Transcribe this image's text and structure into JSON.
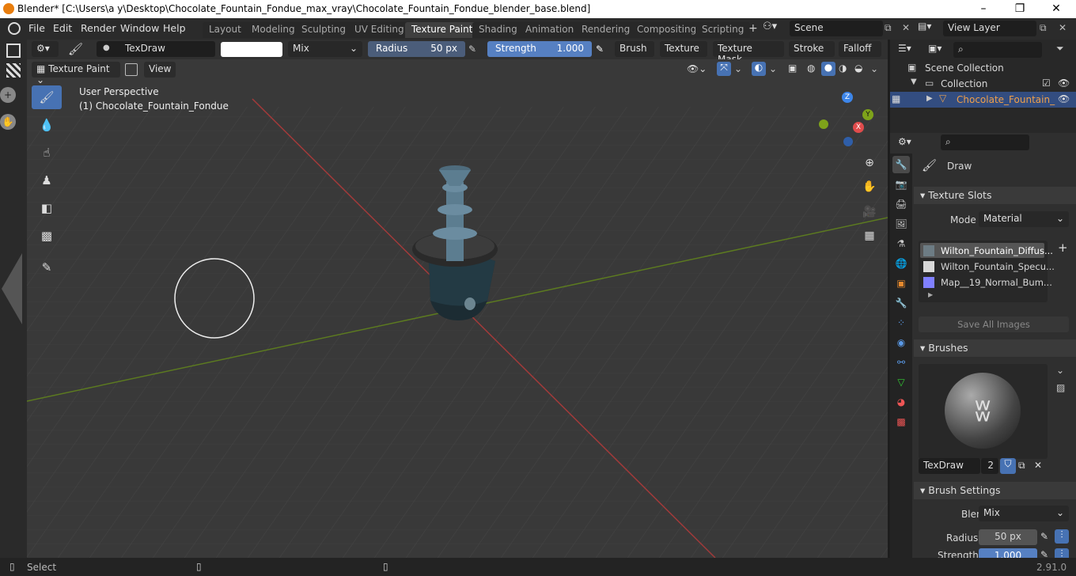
{
  "window": {
    "title": "Blender* [C:\\Users\\a y\\Desktop\\Chocolate_Fountain_Fondue_max_vray\\Chocolate_Fountain_Fondue_blender_base.blend]"
  },
  "menu": [
    "File",
    "Edit",
    "Render",
    "Window",
    "Help"
  ],
  "workspaces": [
    "Layout",
    "Modeling",
    "Sculpting",
    "UV Editing",
    "Texture Paint",
    "Shading",
    "Animation",
    "Rendering",
    "Compositing",
    "Scripting"
  ],
  "active_workspace": "Texture Paint",
  "scene": {
    "name": "Scene"
  },
  "view_layer": {
    "name": "View Layer"
  },
  "tool_header": {
    "brush_name": "TexDraw",
    "blend": "Mix",
    "radius_label": "Radius",
    "radius_value": "50 px",
    "strength_label": "Strength",
    "strength_value": "1.000",
    "menus": [
      "Brush",
      "Texture",
      "Texture Mask",
      "Stroke",
      "Falloff"
    ]
  },
  "mode_header": {
    "mode": "Texture Paint",
    "view": "View"
  },
  "viewport": {
    "perspective": "User Perspective",
    "object": "(1) Chocolate_Fountain_Fondue",
    "gizmo": {
      "z": "Z",
      "y": "Y",
      "x": "X"
    }
  },
  "outliner": {
    "scene_collection": "Scene Collection",
    "collection": "Collection",
    "object": "Chocolate_Fountain_"
  },
  "properties": {
    "active_tool": "Draw",
    "texture_slots_title": "Texture Slots",
    "mode_label": "Mode",
    "mode_value": "Material",
    "slots": [
      {
        "name": "Wilton_Fountain_Diffus...",
        "color": "#6d7c84"
      },
      {
        "name": "Wilton_Fountain_Specu...",
        "color": "#d8d8d8"
      },
      {
        "name": "Map__19_Normal_Bum...",
        "color": "#8080ff"
      }
    ],
    "save_all": "Save All Images",
    "brushes_title": "Brushes",
    "brush_name": "TexDraw",
    "brush_users": "2",
    "brush_settings_title": "Brush Settings",
    "blend_label": "Blend",
    "blend_value": "Mix",
    "radius_label": "Radius",
    "radius_value": "50 px",
    "strength_label": "Strength",
    "strength_value": "1.000"
  },
  "status": {
    "left": "Select",
    "version": "2.91.0"
  },
  "colors": {
    "accent": "#4772b3",
    "slider": "#5680c2",
    "x_axis": "#e04c4c",
    "y_axis": "#7ea31a",
    "z_axis": "#3d86ea"
  }
}
